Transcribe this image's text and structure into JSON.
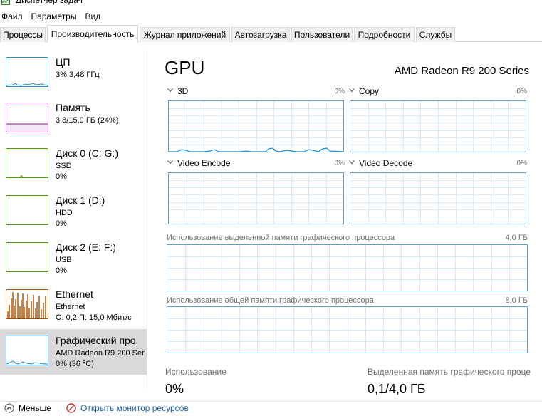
{
  "window": {
    "title": "Диспетчер задач"
  },
  "menu": [
    "Файл",
    "Параметры",
    "Вид"
  ],
  "tabs": [
    {
      "label": "Процессы",
      "active": false
    },
    {
      "label": "Производительность",
      "active": true
    },
    {
      "label": "Журнал приложений",
      "active": false
    },
    {
      "label": "Автозагрузка",
      "active": false
    },
    {
      "label": "Пользователи",
      "active": false
    },
    {
      "label": "Подробности",
      "active": false
    },
    {
      "label": "Службы",
      "active": false
    }
  ],
  "sidebar": [
    {
      "name": "ЦП",
      "line1": "3% 3,48 ГГц",
      "line2": "",
      "color": "#1f8ec8",
      "selected": false
    },
    {
      "name": "Память",
      "line1": "3,8/15,9 ГБ (24%)",
      "line2": "",
      "color": "#8b1b8b",
      "selected": false
    },
    {
      "name": "Диск 0 (C: G:)",
      "line1": "SSD",
      "line2": "0%",
      "color": "#4d9a06",
      "selected": false
    },
    {
      "name": "Диск 1 (D:)",
      "line1": "HDD",
      "line2": "0%",
      "color": "#4d9a06",
      "selected": false
    },
    {
      "name": "Диск 2 (E: F:)",
      "line1": "USB",
      "line2": "0%",
      "color": "#4d9a06",
      "selected": false
    },
    {
      "name": "Ethernet",
      "line1": "Ethernet",
      "line2": "О: 0,2 П: 15,0 Мбит/с",
      "color": "#a74f01",
      "selected": false
    },
    {
      "name": "Графический про",
      "line1": "AMD Radeon R9 200 Ser",
      "line2": "0% (36 °C)",
      "color": "#1f8ec8",
      "selected": true
    }
  ],
  "main": {
    "title": "GPU",
    "model": "AMD Radeon R9 200 Series",
    "engines": [
      {
        "name": "3D",
        "percent": "0%"
      },
      {
        "name": "Copy",
        "percent": "0%"
      },
      {
        "name": "Video Encode",
        "percent": "0%"
      },
      {
        "name": "Video Decode",
        "percent": "0%"
      }
    ],
    "dedicated_memory": {
      "label": "Использование выделенной памяти графического процессора",
      "max": "4,0 ГБ"
    },
    "shared_memory": {
      "label": "Использование общей памяти графического процессора",
      "max": "8,0 ГБ"
    },
    "stats": {
      "usage_label": "Использование",
      "usage_value": "0%",
      "dedicated_label": "Выделенная память графического проце",
      "dedicated_value": "0,1/4,0 ГБ"
    }
  },
  "footer": {
    "less_label": "Меньше",
    "monitor_label": "Открыть монитор ресурсов"
  },
  "colors": {
    "gpu_line": "#1f8ec8",
    "grid": "#d9eaf5",
    "graph_border": "#5ea0c9",
    "selected_bg": "#d9d9d9"
  }
}
